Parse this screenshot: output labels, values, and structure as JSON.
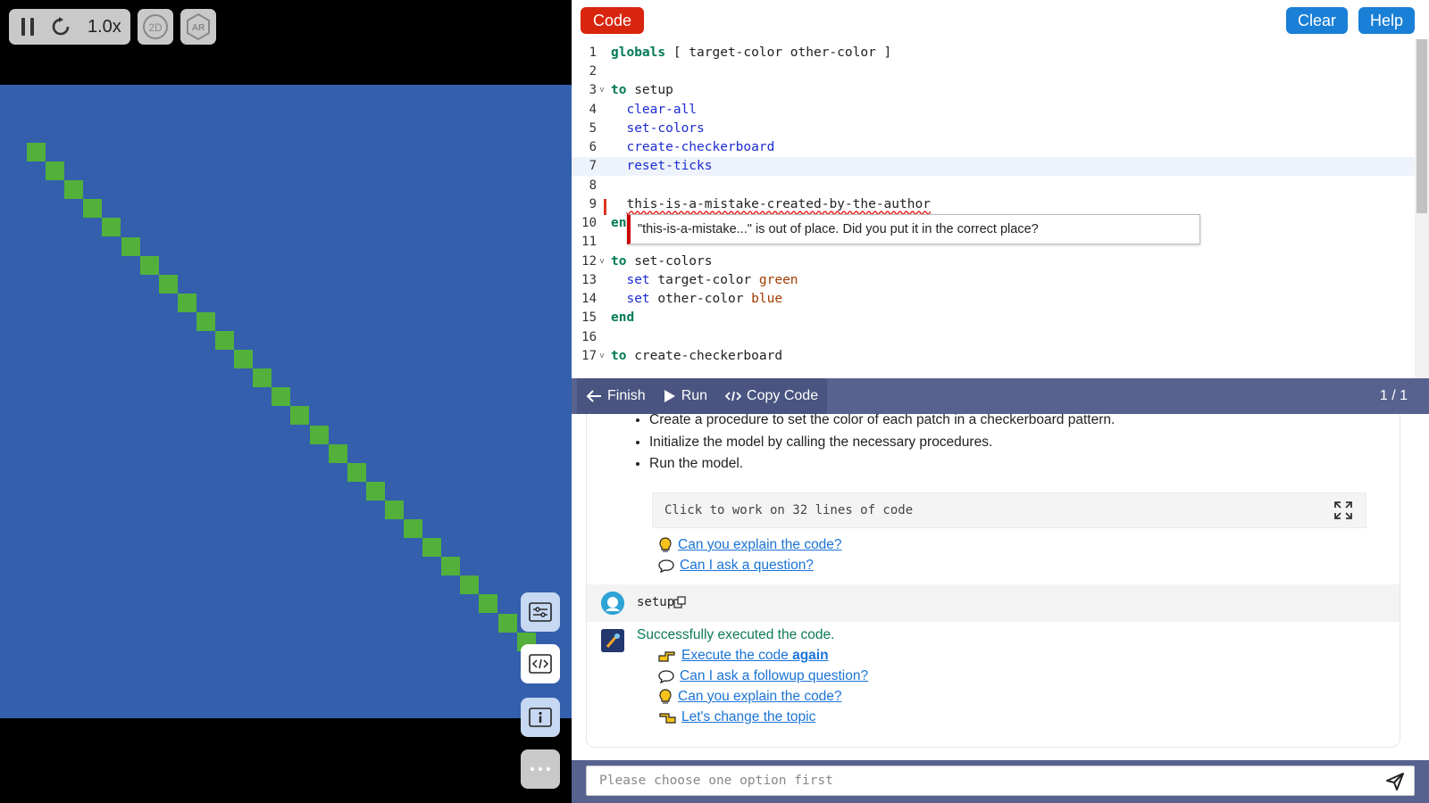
{
  "playback": {
    "speed": "1.0x",
    "mode_2d": "2D",
    "mode_ar": "AR"
  },
  "colors": {
    "world_bg": "#345fac",
    "patch_green": "#52b03b",
    "panel_bar": "#57628f",
    "code_button": "#d8250d",
    "blue_button": "#1a7fd6"
  },
  "header": {
    "code_button": "Code",
    "clear_button": "Clear",
    "help_button": "Help"
  },
  "editor": {
    "lines": [
      {
        "n": "1",
        "fold": "",
        "html": "<span class=\"kw\">globals</span> [ target-color other-color ]"
      },
      {
        "n": "2",
        "fold": "",
        "html": ""
      },
      {
        "n": "3",
        "fold": "v",
        "html": "<span class=\"kw\">to</span> setup"
      },
      {
        "n": "4",
        "fold": "",
        "html": "  <span class=\"prim\">clear-all</span>"
      },
      {
        "n": "5",
        "fold": "",
        "html": "  <span class=\"prim\">set-colors</span>"
      },
      {
        "n": "6",
        "fold": "",
        "html": "  <span class=\"prim\">create-checkerboard</span>"
      },
      {
        "n": "7",
        "fold": "",
        "html": "  <span class=\"prim\">reset-ticks</span>"
      },
      {
        "n": "8",
        "fold": "",
        "html": ""
      },
      {
        "n": "9",
        "fold": "",
        "html": "  <span class=\"err\">this-is-a-mistake-created-by-the-author</span>"
      },
      {
        "n": "10",
        "fold": "",
        "html": "<span class=\"kw\">en</span>"
      },
      {
        "n": "11",
        "fold": "",
        "html": ""
      },
      {
        "n": "12",
        "fold": "v",
        "html": "<span class=\"kw\">to</span> set-colors"
      },
      {
        "n": "13",
        "fold": "",
        "html": "  <span class=\"prim\">set</span> target-color <span class=\"cst\">green</span>"
      },
      {
        "n": "14",
        "fold": "",
        "html": "  <span class=\"prim\">set</span> other-color <span class=\"cst\">blue</span>"
      },
      {
        "n": "15",
        "fold": "",
        "html": "<span class=\"kw\">end</span>"
      },
      {
        "n": "16",
        "fold": "",
        "html": ""
      },
      {
        "n": "17",
        "fold": "v",
        "html": "<span class=\"kw\">to</span> create-checkerboard"
      }
    ],
    "active_line": "7",
    "tooltip": "\"this-is-a-mistake...\" is out of place. Did you put it in the correct place?"
  },
  "command_bar": {
    "finish": "Finish",
    "run": "Run",
    "copy_code": "Copy Code",
    "pager": "1 / 1"
  },
  "chat": {
    "bullets": [
      "Create a procedure to set the color of each patch in a checkerboard pattern.",
      "Initialize the model by calling the necessary procedures.",
      "Run the model."
    ],
    "code_box": "Click to work on 32 lines of code",
    "links_1": {
      "explain": "Can you explain the code?",
      "ask": "Can I ask a question?"
    },
    "user_message": "setup",
    "bot_status": "Successfully executed the code.",
    "execute_prefix": "Execute the code ",
    "execute_suffix": "again",
    "followup": "Can I ask a followup question?",
    "explain_again": "Can you explain the code?",
    "change_topic": "Let's change the topic"
  },
  "input": {
    "placeholder": "Please choose one option first"
  }
}
